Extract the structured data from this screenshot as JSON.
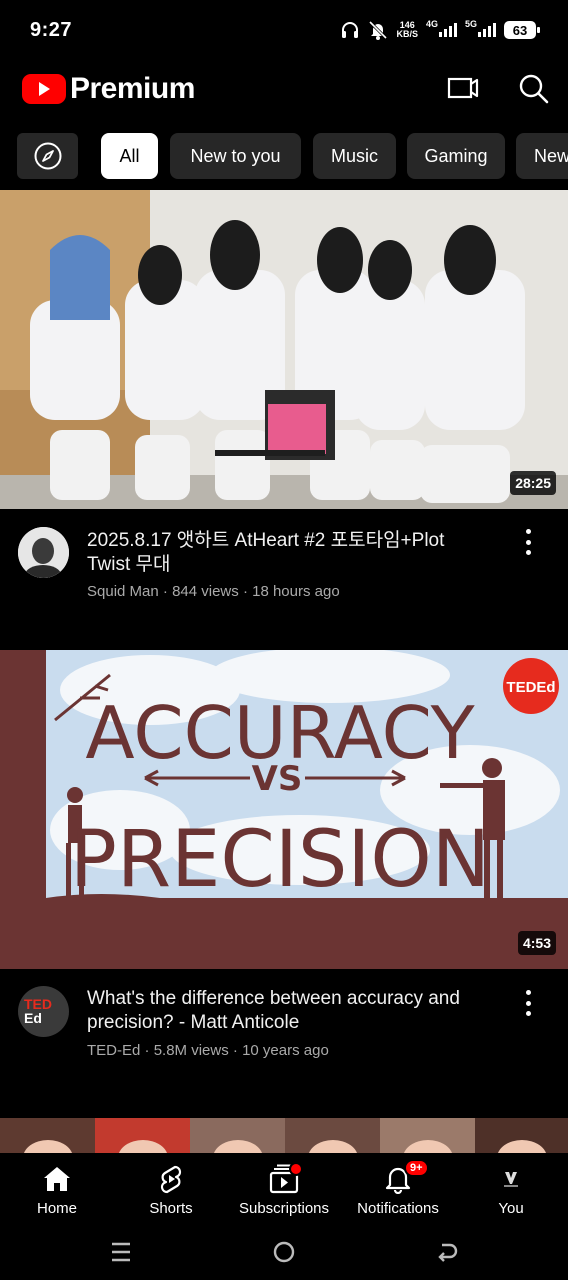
{
  "status_bar": {
    "time": "9:27",
    "net_speed_value": "146",
    "net_speed_unit": "KB/S",
    "signal1_label": "4G",
    "signal2_label": "5G",
    "battery": "63"
  },
  "header": {
    "brand": "Premium"
  },
  "chips": [
    "All",
    "New to you",
    "Music",
    "Gaming",
    "New"
  ],
  "videos": [
    {
      "title": "2025.8.17 앳하트 AtHeart #2 포토타임+Plot Twist 무대",
      "channel": "Squid Man",
      "views": "844 views",
      "age": "18 hours ago",
      "duration": "28:25"
    },
    {
      "title": "What's the difference between accuracy and precision? - Matt Anticole",
      "channel": "TED-Ed",
      "views": "5.8M views",
      "age": "10 years ago",
      "duration": "4:53",
      "thumb_line1": "ACCURACY",
      "thumb_line2": "VS",
      "thumb_line3": "PRECISION",
      "badge": "TEDEd",
      "avatar_line1": "TED",
      "avatar_line2": "Ed"
    }
  ],
  "meta_separator": "·",
  "bottom_nav": {
    "home": "Home",
    "shorts": "Shorts",
    "subscriptions": "Subscriptions",
    "notifications": "Notifications",
    "notifications_badge": "9+",
    "you": "You"
  },
  "colors": {
    "accent": "#ff0000",
    "chip_bg": "#272727",
    "ted_red": "#e62b1e",
    "thumb_brown": "#6b3433"
  }
}
